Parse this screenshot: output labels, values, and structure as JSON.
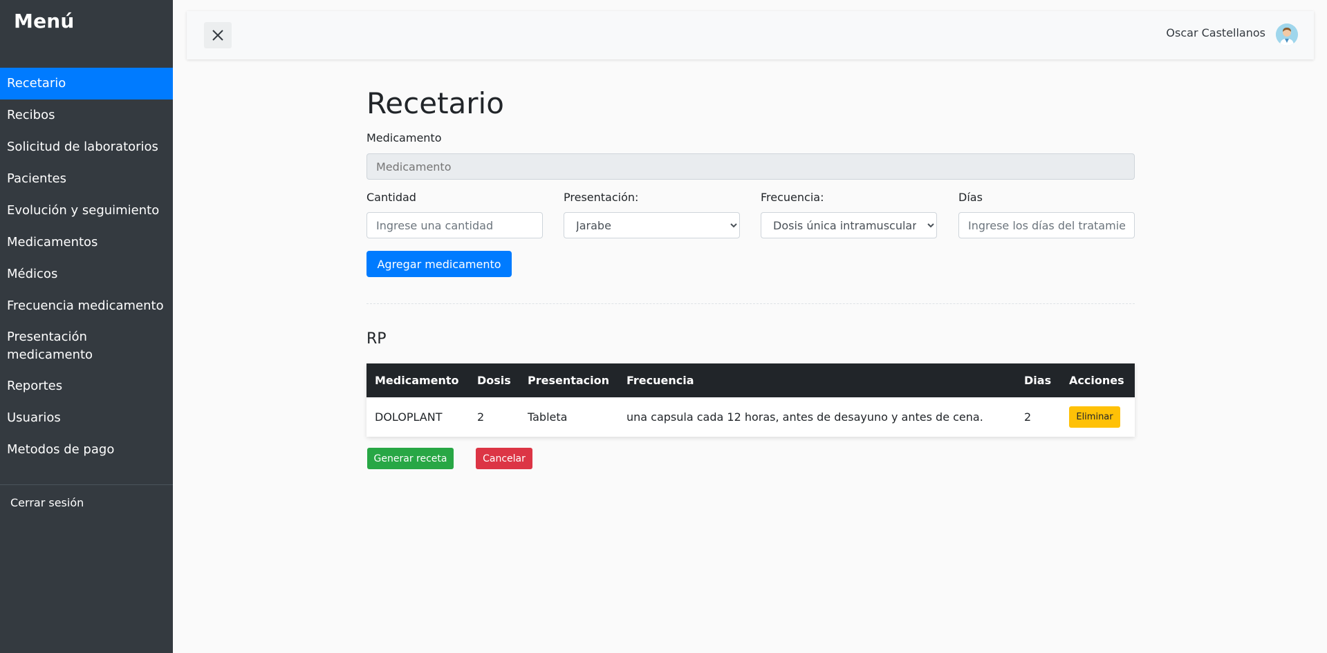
{
  "sidebar": {
    "title": "Menú",
    "items": [
      {
        "label": "Recetario",
        "active": true
      },
      {
        "label": "Recibos"
      },
      {
        "label": "Solicitud de laboratorios"
      },
      {
        "label": "Pacientes"
      },
      {
        "label": "Evolución y seguimiento"
      },
      {
        "label": "Medicamentos"
      },
      {
        "label": "Médicos"
      },
      {
        "label": "Frecuencia medicamento"
      },
      {
        "label": "Presentación medicamento"
      },
      {
        "label": "Reportes"
      },
      {
        "label": "Usuarios"
      },
      {
        "label": "Metodos de pago"
      }
    ],
    "logout": "Cerrar sesión"
  },
  "topbar": {
    "close_icon": "close-icon",
    "user_name": "Oscar Castellanos",
    "avatar_icon": "doctor-avatar"
  },
  "main": {
    "title": "Recetario",
    "medicamento": {
      "label": "Medicamento",
      "placeholder": "Medicamento"
    },
    "cantidad": {
      "label": "Cantidad",
      "placeholder": "Ingrese una cantidad"
    },
    "presentacion": {
      "label": "Presentación:",
      "selected": "Jarabe"
    },
    "frecuencia": {
      "label": "Frecuencia:",
      "selected": "Dosis única intramuscular"
    },
    "dias": {
      "label": "Días",
      "placeholder": "Ingrese los días del tratamiento"
    },
    "add_button": "Agregar medicamento",
    "rp_title": "RP",
    "table": {
      "headers": [
        "Medicamento",
        "Dosis",
        "Presentacion",
        "Frecuencia",
        "Dias",
        "Acciones"
      ],
      "rows": [
        {
          "medicamento": "DOLOPLANT",
          "dosis": "2",
          "presentacion": "Tableta",
          "frecuencia": "una capsula cada 12 horas, antes de desayuno y antes de cena.",
          "dias": "2",
          "accion": "Eliminar"
        }
      ]
    },
    "generate_button": "Generar receta",
    "cancel_button": "Cancelar"
  },
  "colors": {
    "sidebar_bg": "#343a40",
    "active": "#007bff",
    "success": "#28a745",
    "danger": "#dc3545",
    "warning": "#ffc107",
    "table_header": "#212529"
  }
}
